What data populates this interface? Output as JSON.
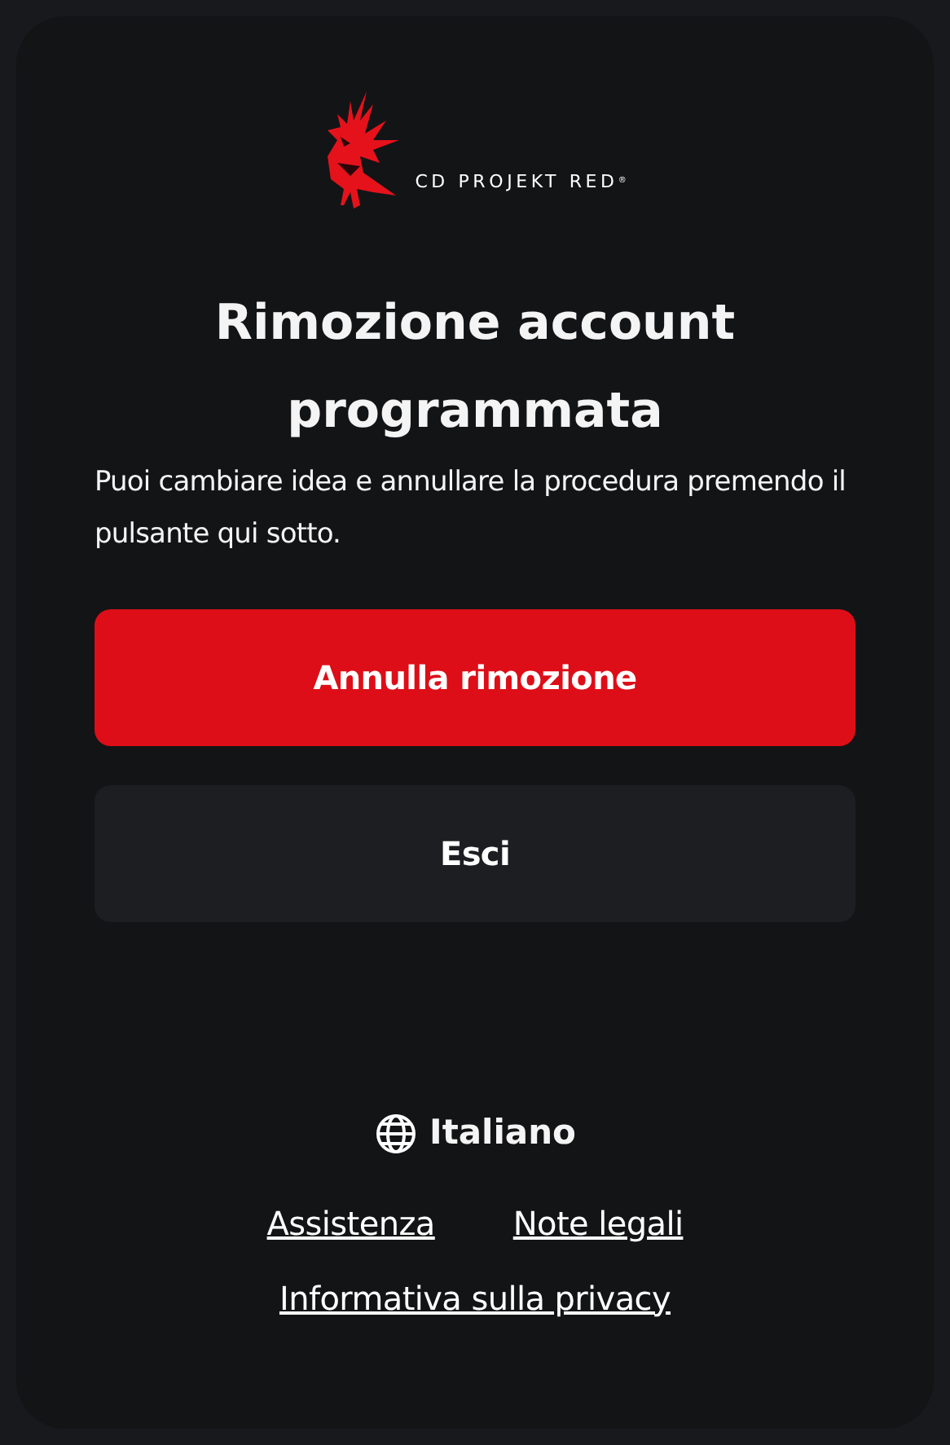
{
  "logo": {
    "text": "CD PROJEKT RED$^{®}$"
  },
  "title": "Rimozione account programmata",
  "message": "Puoi cambiare idea e annullare la procedura premendo il pulsante qui sotto.",
  "buttons": [
    {
      "label": "Annulla rimozione",
      "kind": "primary"
    },
    {
      "label": "Esci",
      "kind": "secondary"
    }
  ],
  "language": "Italiano",
  "links": [
    "Assistenza",
    "Note legali",
    "Informativa sulla privacy"
  ]
}
